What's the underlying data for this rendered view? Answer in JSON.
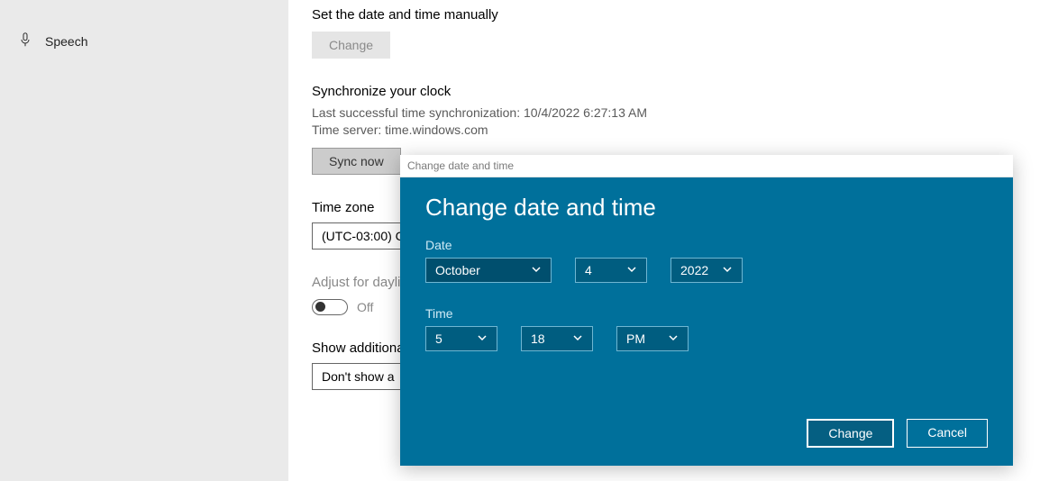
{
  "sidebar": {
    "items": [
      {
        "label": "Speech"
      }
    ]
  },
  "manual": {
    "title": "Set the date and time manually",
    "change_btn": "Change"
  },
  "sync": {
    "title": "Synchronize your clock",
    "last": "Last successful time synchronization: 10/4/2022 6:27:13 AM",
    "server": "Time server: time.windows.com",
    "btn": "Sync now"
  },
  "tz": {
    "title": "Time zone",
    "value": "(UTC-03:00) C"
  },
  "dst": {
    "title": "Adjust for dayli",
    "state": "Off"
  },
  "additional": {
    "title": "Show additiona",
    "value": "Don't show a"
  },
  "modal": {
    "window_title": "Change date and time",
    "heading": "Change date and time",
    "date_label": "Date",
    "time_label": "Time",
    "month": "October",
    "day": "4",
    "year": "2022",
    "hour": "5",
    "minute": "18",
    "ampm": "PM",
    "change_btn": "Change",
    "cancel_btn": "Cancel"
  }
}
